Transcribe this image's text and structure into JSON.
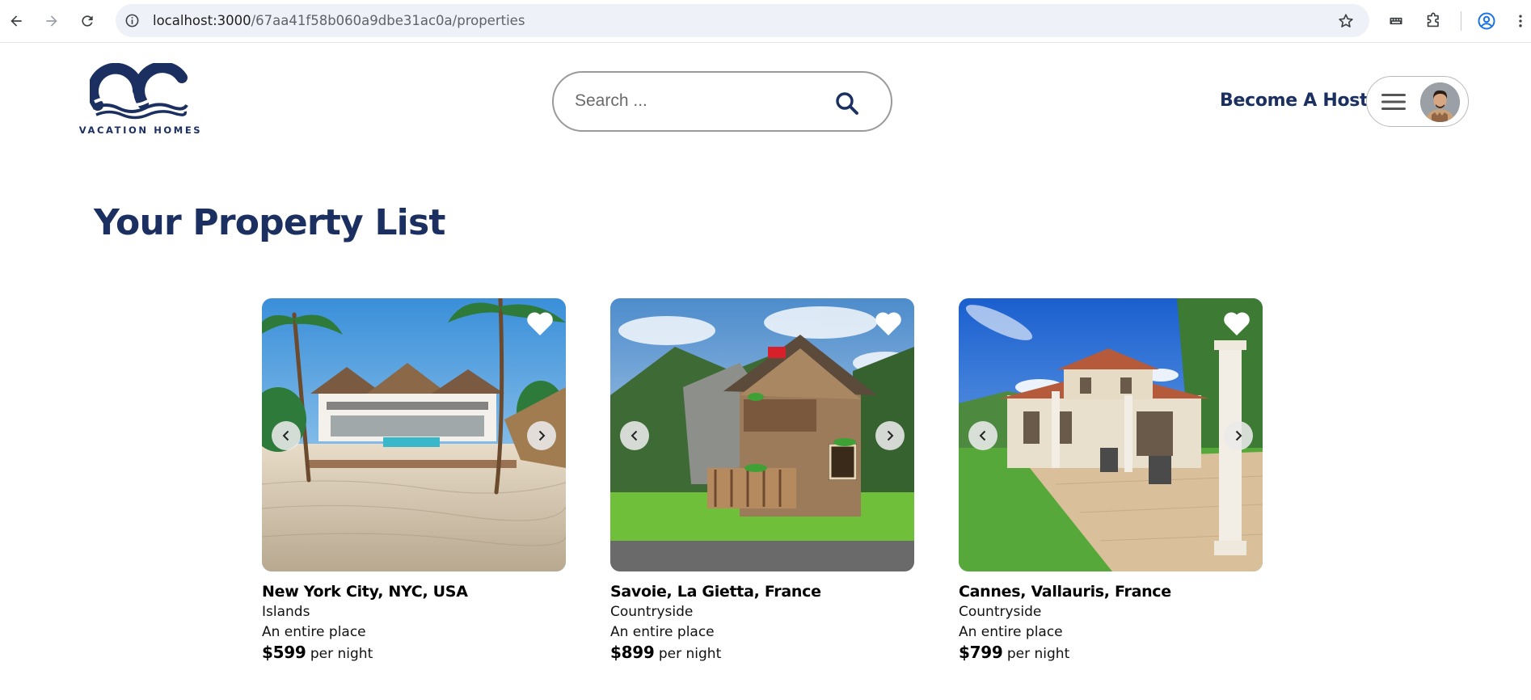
{
  "browser": {
    "url_host": "localhost:3000",
    "url_path": "/67aa41f58b060a9dbe31ac0a/properties",
    "icons": [
      "back-icon",
      "forward-icon",
      "reload-icon",
      "site-info-icon",
      "bookmark-star-icon",
      "translate-icon",
      "extensions-icon",
      "profile-icon",
      "more-menu-icon"
    ]
  },
  "header": {
    "logo_text": "VACATION HOMES",
    "search_placeholder": "Search ...",
    "become_host_label": "Become A Host",
    "brand_color": "#1b3060"
  },
  "main": {
    "title": "Your Property List",
    "properties": [
      {
        "location": "New York City, NYC, USA",
        "category": "Islands",
        "type": "An entire place",
        "price": "$599",
        "price_suffix": "per night",
        "image_subject": "beachfront villa with palm trees"
      },
      {
        "location": "Savoie, La Gietta, France",
        "category": "Countryside",
        "type": "An entire place",
        "price": "$899",
        "price_suffix": "per night",
        "image_subject": "wooden alpine chalet"
      },
      {
        "location": "Cannes, Vallauris, France",
        "category": "Countryside",
        "type": "An entire place",
        "price": "$799",
        "price_suffix": "per night",
        "image_subject": "provençal villa with terrace"
      }
    ]
  }
}
